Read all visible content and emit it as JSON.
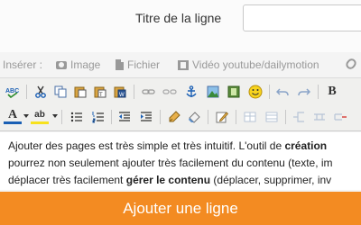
{
  "form": {
    "title_label": "Titre de la ligne",
    "title_value": ""
  },
  "insert_bar": {
    "label": "Insérer :",
    "items": [
      {
        "label": "Image",
        "icon": "camera-icon"
      },
      {
        "label": "Fichier",
        "icon": "file-icon"
      },
      {
        "label": "Vidéo youtube/dailymotion",
        "icon": "film-icon"
      }
    ],
    "extra_icon": "link-icon"
  },
  "toolbar": {
    "row1": [
      "spellcheck-icon",
      "cut-icon",
      "copy-icon",
      "paste-icon",
      "paste-text-icon",
      "paste-word-icon",
      "link-icon",
      "unlink-icon",
      "anchor-icon",
      "image-icon",
      "media-icon",
      "emoticon-icon",
      "undo-icon",
      "redo-icon",
      "bold-icon"
    ],
    "row2": [
      "font-color-icon",
      "highlight-color-icon",
      "bullet-list-icon",
      "numbered-list-icon",
      "outdent-icon",
      "indent-icon",
      "clean-format-icon",
      "eraser-icon",
      "edit-icon",
      "table-icon",
      "table-row-icon",
      "table-split-icon",
      "table-cols-icon",
      "table-delete-icon"
    ],
    "bold_glyph": "B",
    "font_color_glyph": "A",
    "highlight_glyph": "ab"
  },
  "content": {
    "line1_a": "Ajouter des pages est très simple et très intuitif. L'outil de ",
    "line1_b": "création",
    "line2": "pourrez non seulement ajouter très facilement du contenu (texte, im",
    "line3_a": "déplacer très facilement ",
    "line3_b": "gérer le contenu",
    "line3_c": " (déplacer, supprimer, inv"
  },
  "submit": {
    "label": "Ajouter une ligne"
  },
  "colors": {
    "accent": "#f38b22",
    "toolbar_bg": "#f0f0ee"
  }
}
